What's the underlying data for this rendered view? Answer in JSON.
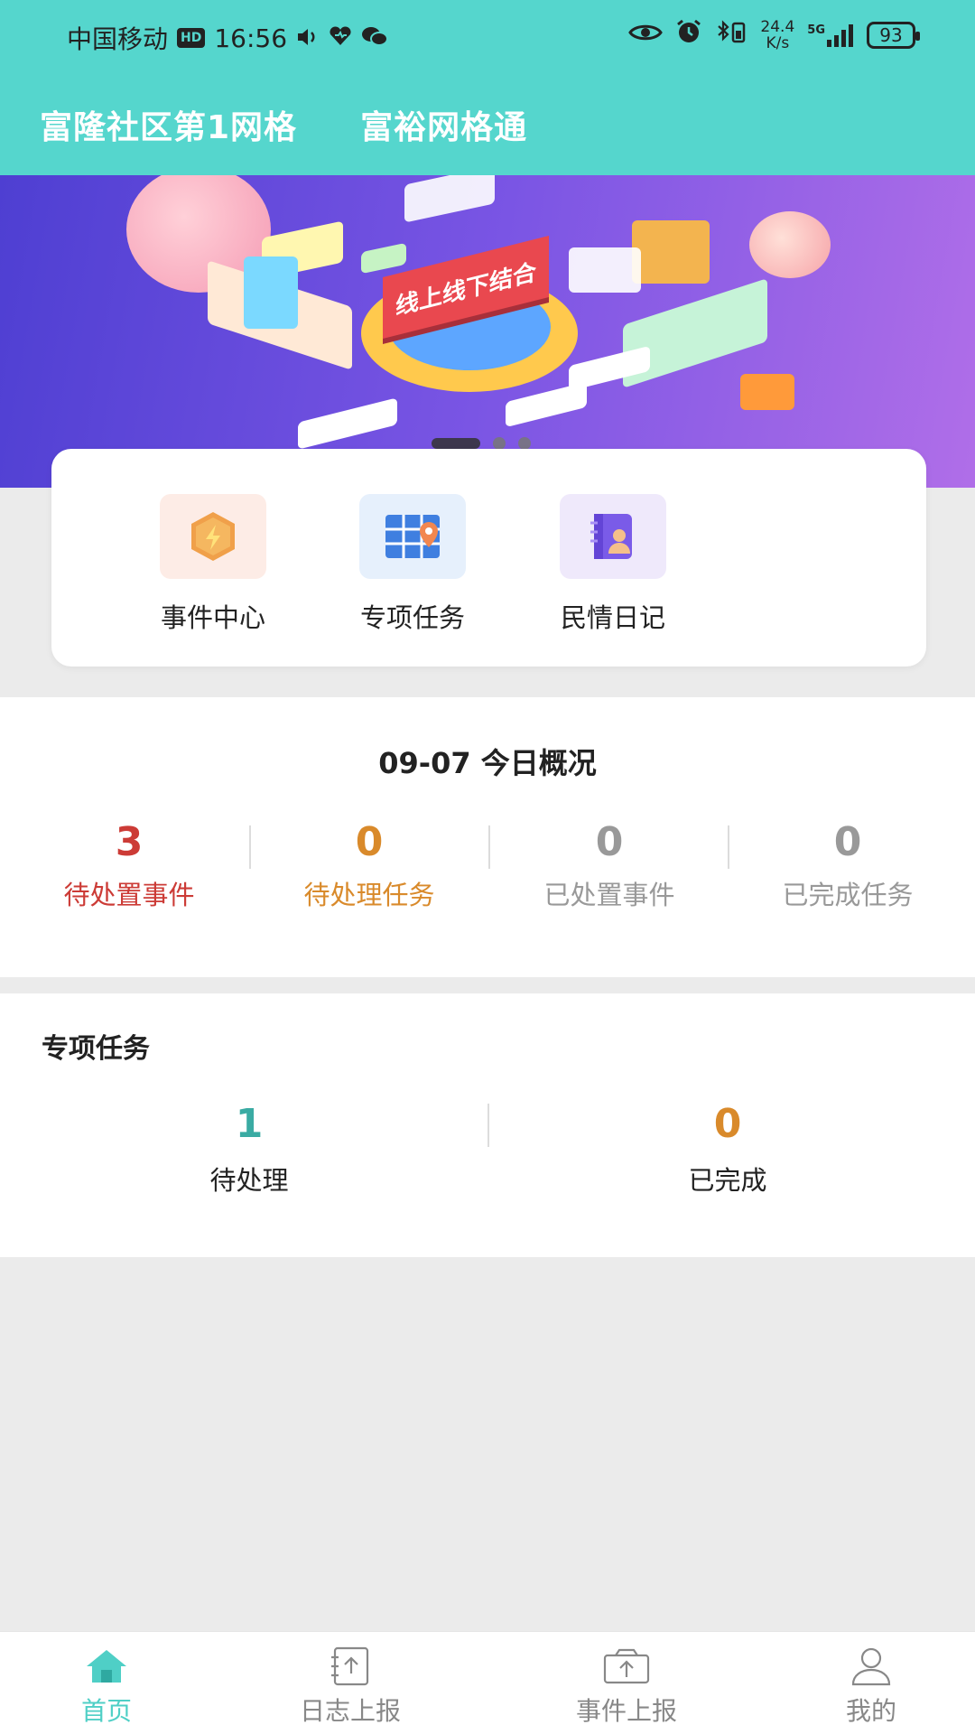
{
  "status_bar": {
    "carrier": "中国移动",
    "hd_badge": "HD",
    "time": "16:56",
    "net_speed_value": "24.4",
    "net_speed_unit": "K/s",
    "signal_label": "5G",
    "battery": "93"
  },
  "header": {
    "grid_name": "富隆社区第1网格",
    "app_name": "富裕网格通"
  },
  "banner": {
    "sign_text": "线上线下结合",
    "slide_count": 3,
    "active_slide": 1
  },
  "quick_menu": {
    "items": [
      {
        "label": "事件中心",
        "icon": "lightning-hexagon-icon"
      },
      {
        "label": "专项任务",
        "icon": "map-grid-pin-icon"
      },
      {
        "label": "民情日记",
        "icon": "diary-people-icon"
      }
    ]
  },
  "overview": {
    "title": "09-07 今日概况",
    "stats": [
      {
        "value": "3",
        "label": "待处置事件",
        "color": "#cc3b36"
      },
      {
        "value": "0",
        "label": "待处理任务",
        "color": "#d98a2b"
      },
      {
        "value": "0",
        "label": "已处置事件",
        "color": "#999999"
      },
      {
        "value": "0",
        "label": "已完成任务",
        "color": "#999999"
      }
    ]
  },
  "special_tasks": {
    "title": "专项任务",
    "stats": [
      {
        "value": "1",
        "label": "待处理",
        "color": "#3aaba3"
      },
      {
        "value": "0",
        "label": "已完成",
        "color": "#d98a2b"
      }
    ]
  },
  "bottom_nav": {
    "items": [
      {
        "label": "首页",
        "icon": "home-icon",
        "active": true
      },
      {
        "label": "日志上报",
        "icon": "log-upload-icon",
        "active": false
      },
      {
        "label": "事件上报",
        "icon": "event-upload-icon",
        "active": false
      },
      {
        "label": "我的",
        "icon": "user-icon",
        "active": false
      }
    ]
  },
  "colors": {
    "header": "#55d6cd",
    "accent": "#4fcfc6",
    "background": "#ebebeb"
  }
}
